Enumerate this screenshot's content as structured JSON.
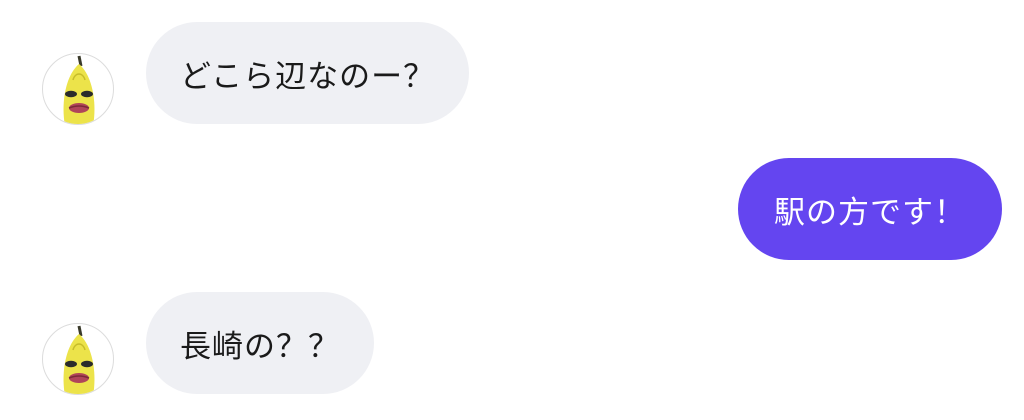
{
  "chat": {
    "messages": [
      {
        "sender": "other",
        "avatar_icon": "banana-avatar-icon",
        "text": "どこら辺なのー？"
      },
      {
        "sender": "me",
        "text": "駅の方です！"
      },
      {
        "sender": "other",
        "avatar_icon": "banana-avatar-icon",
        "text": "長崎の？？"
      }
    ]
  },
  "colors": {
    "incoming_bubble": "#eff0f4",
    "outgoing_bubble": "#6445f0",
    "outgoing_text": "#ffffff",
    "incoming_text": "#1a1a1a"
  }
}
